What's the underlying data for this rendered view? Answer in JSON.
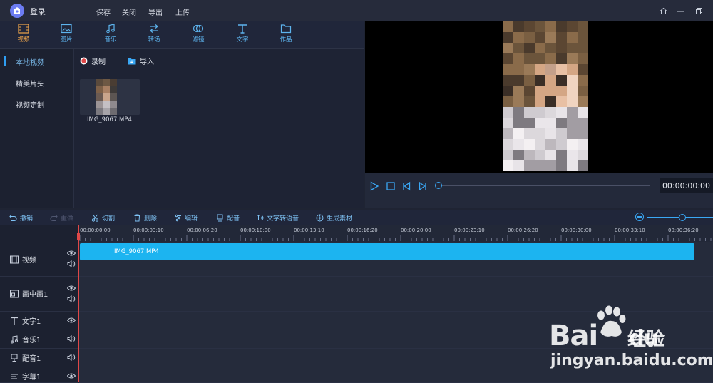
{
  "app": {
    "login_label": "登录",
    "menu": [
      "保存",
      "关闭",
      "导出",
      "上传"
    ],
    "accent_color": "#1cb4f0",
    "highlight_color": "#f1a74b"
  },
  "categories": [
    {
      "label": "视频",
      "icon": "film-icon",
      "active": true
    },
    {
      "label": "图片",
      "icon": "image-icon"
    },
    {
      "label": "音乐",
      "icon": "music-icon"
    },
    {
      "label": "转场",
      "icon": "transition-icon"
    },
    {
      "label": "滤镜",
      "icon": "filter-icon"
    },
    {
      "label": "文字",
      "icon": "text-icon"
    },
    {
      "label": "作品",
      "icon": "folder-icon"
    }
  ],
  "sidebar": {
    "items": [
      "本地视频",
      "精美片头",
      "视频定制"
    ]
  },
  "media": {
    "record_label": "录制",
    "import_label": "导入",
    "file_name": "IMG_9067.MP4"
  },
  "player": {
    "timecode": "00:00:00:00"
  },
  "toolbar": {
    "undo": "撤销",
    "redo": "重做",
    "cut": "切割",
    "delete": "删除",
    "edit": "编辑",
    "dub": "配音",
    "tts": "文字转语音",
    "generate": "生成素材"
  },
  "ruler": {
    "ticks": [
      "00:00:00:00",
      "00:00:03:10",
      "00:00:06:20",
      "00:00:10:00",
      "00:00:13:10",
      "00:00:16:20",
      "00:00:20:00",
      "00:00:23:10",
      "00:00:26:20",
      "00:00:30:00",
      "00:00:33:10",
      "00:00:36:20"
    ]
  },
  "tracks": [
    {
      "name": "视频",
      "icon": "film-icon"
    },
    {
      "name": "画中画1",
      "icon": "pip-icon"
    },
    {
      "name": "文字1",
      "icon": "text-icon"
    },
    {
      "name": "音乐1",
      "icon": "music-icon"
    },
    {
      "name": "配音1",
      "icon": "mic-icon"
    },
    {
      "name": "字幕1",
      "icon": "subtitle-icon"
    }
  ],
  "timeline_clip": {
    "name": "IMG_9067.MP4"
  },
  "watermark": {
    "brand": "Bai",
    "brand_suffix": "du",
    "cn": "经验",
    "url": "jingyan.baidu.com"
  }
}
